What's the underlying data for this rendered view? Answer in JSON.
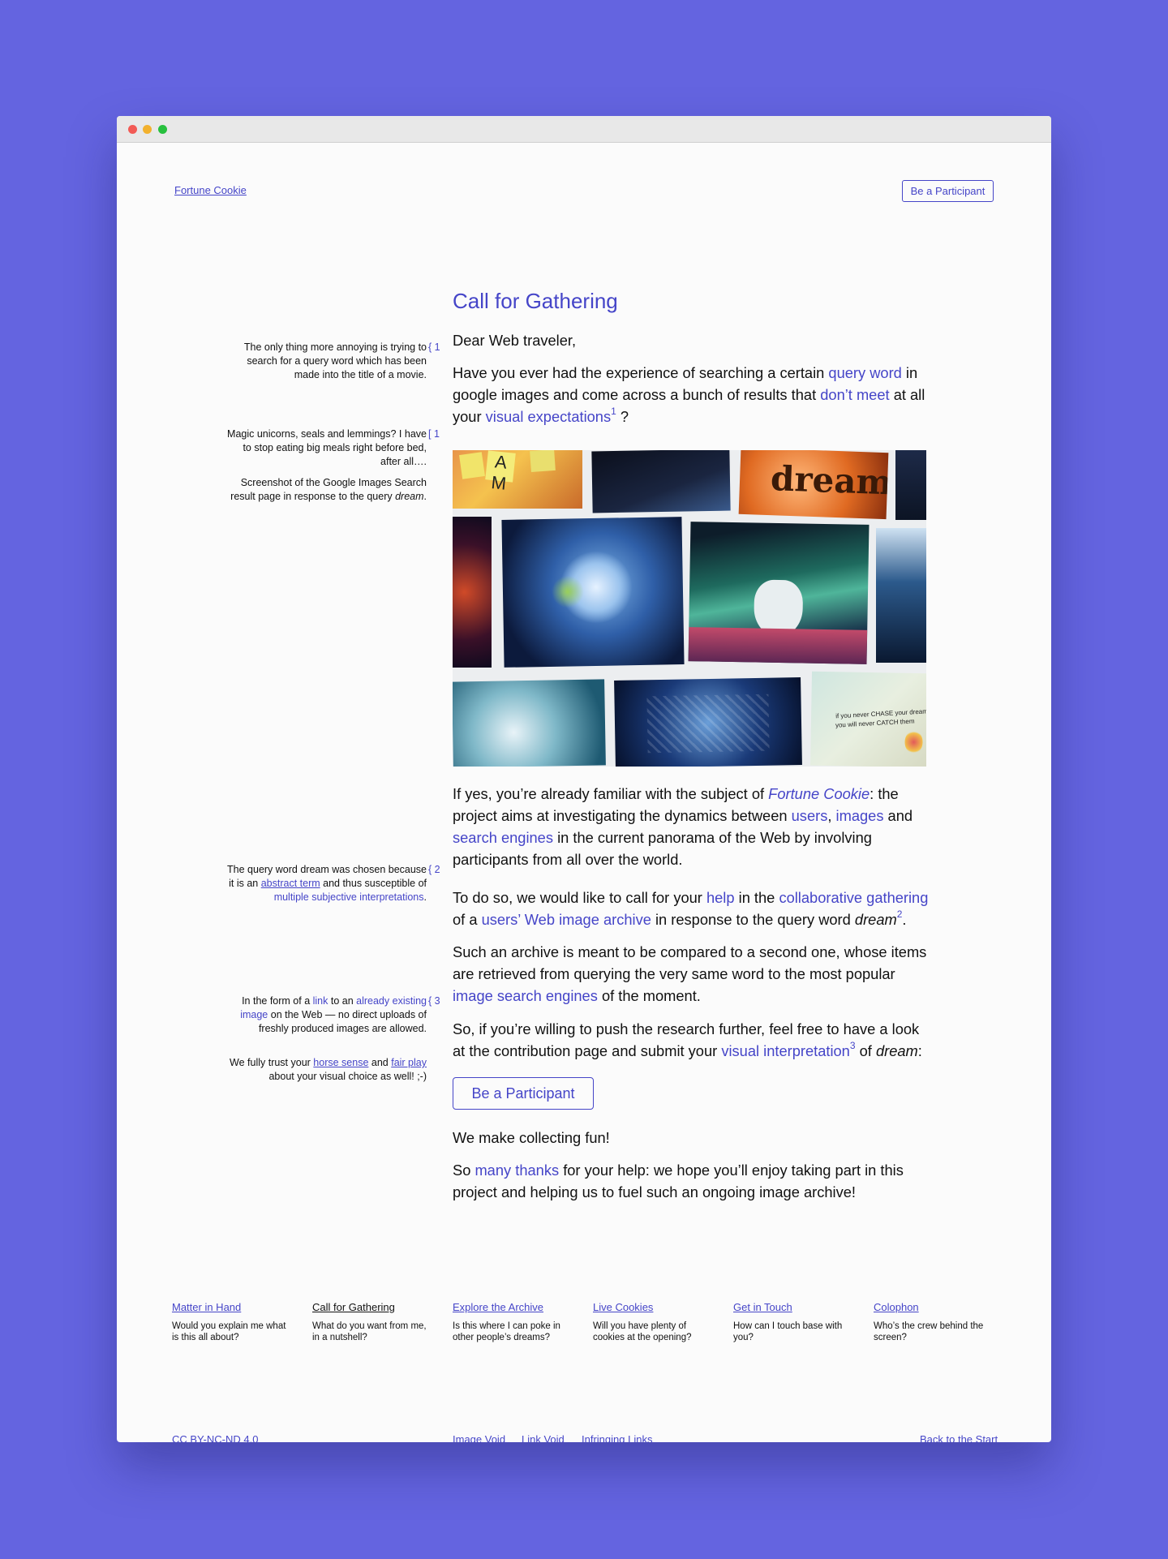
{
  "header": {
    "site_name": "Fortune Cookie",
    "cta_label": "Be a Participant"
  },
  "main": {
    "title": "Call for Gathering",
    "greeting": "Dear Web traveler,",
    "p1": {
      "a": "Have you ever had the experience of searching a certain ",
      "l1": "query word",
      "b": " in google images and come across a bunch of results that ",
      "l2": "don’t meet",
      "c": " at all your ",
      "l3": "visual expectations",
      "sup": "1",
      "d": " ?"
    },
    "p2": {
      "a": "If yes, you’re already familiar with the subject of ",
      "l1": "Fortune Cookie",
      "b": ": the project aims at investigating the dynamics between ",
      "l2": "users",
      "c": ", ",
      "l3": "images",
      "d": " and ",
      "l4": "search engines",
      "e": " in the current panorama of the Web by involving participants from all over the world."
    },
    "p3": {
      "a": "To do so, we would like to call for your ",
      "l1": "help",
      "b": " in the ",
      "l2": "collaborative gathering",
      "c": " of a ",
      "l3": "users’ Web image archive",
      "d": " in response to the query word ",
      "word": "dream",
      "sup": "2",
      "e": "."
    },
    "p4": {
      "a": "Such an archive is meant to be compared to a second one, whose items are retrieved from querying the very same word to the most popular ",
      "l1": "image search engines",
      "b": " of the moment."
    },
    "p5": {
      "a": "So, if you’re willing to push the research further, feel free to have a look at the contribution page and submit your ",
      "l1": "visual interpretation",
      "sup": "3",
      "b": " of ",
      "word": "dream",
      "c": ":"
    },
    "cta_label": "Be a Participant",
    "p6": "We make collecting fun!",
    "p7": {
      "a": "So ",
      "l1": "many thanks",
      "b": " for your help: we hope you’ll enjoy taking part in this project and helping us to fuel such an ongoing image archive!"
    },
    "hero_overlay_text": {
      "t1": "dream",
      "t2": "if you never CHASE your dreams",
      "t3": "you will never CATCH them",
      "t4": "A M"
    }
  },
  "sidenotes": {
    "n1": {
      "text": "The only thing more annoying is trying to search for a query word which has been made into the title of a movie.",
      "marker": "{ 1"
    },
    "n2": {
      "text": "Magic unicorns, seals and lemmings? I have to stop eating big meals right before bed, after all….",
      "marker": "[ 1"
    },
    "n2b": {
      "a": "Screenshot of the Google Images Search result page in response to the query ",
      "word": "dream",
      "b": "."
    },
    "n3": {
      "a": "The query word dream was chosen because it is an ",
      "l1": "abstract term",
      "b": " and thus susceptible of ",
      "l2": "multiple subjective interpretations",
      "c": ".",
      "marker": "{ 2"
    },
    "n4": {
      "a": "In the form of a ",
      "l1": "link",
      "b": " to an ",
      "l2": "already existing image",
      "c": " on the Web — no direct uploads of freshly produced images are allowed.",
      "marker": "{ 3"
    },
    "n4b": {
      "a": "We fully trust your ",
      "l1": "horse sense",
      "b": " and ",
      "l2": "fair play",
      "c": " about your visual choice as well! ;-)"
    }
  },
  "footer_nav": [
    {
      "title": "Matter in Hand",
      "desc": "Would you explain me what is this all about?"
    },
    {
      "title": "Call for Gathering",
      "desc": "What do you want from me, in a nutshell?"
    },
    {
      "title": "Explore the Archive",
      "desc": "Is this where I can poke in other people’s dreams?"
    },
    {
      "title": "Live Cookies",
      "desc": "Will you have plenty of cookies at the opening?"
    },
    {
      "title": "Get in Touch",
      "desc": "How can I touch base with you?"
    },
    {
      "title": "Colophon",
      "desc": "Who’s the crew behind the screen?"
    }
  ],
  "bottom": {
    "license": "CC BY-NC-ND 4.0",
    "image_void": "Image Void",
    "link_void": "Link Void",
    "infringing": "Infringing Links",
    "back": "Back to the Start"
  },
  "colors": {
    "accent": "#4545c8",
    "background": "#6464e0",
    "page": "#fbfbfb"
  }
}
